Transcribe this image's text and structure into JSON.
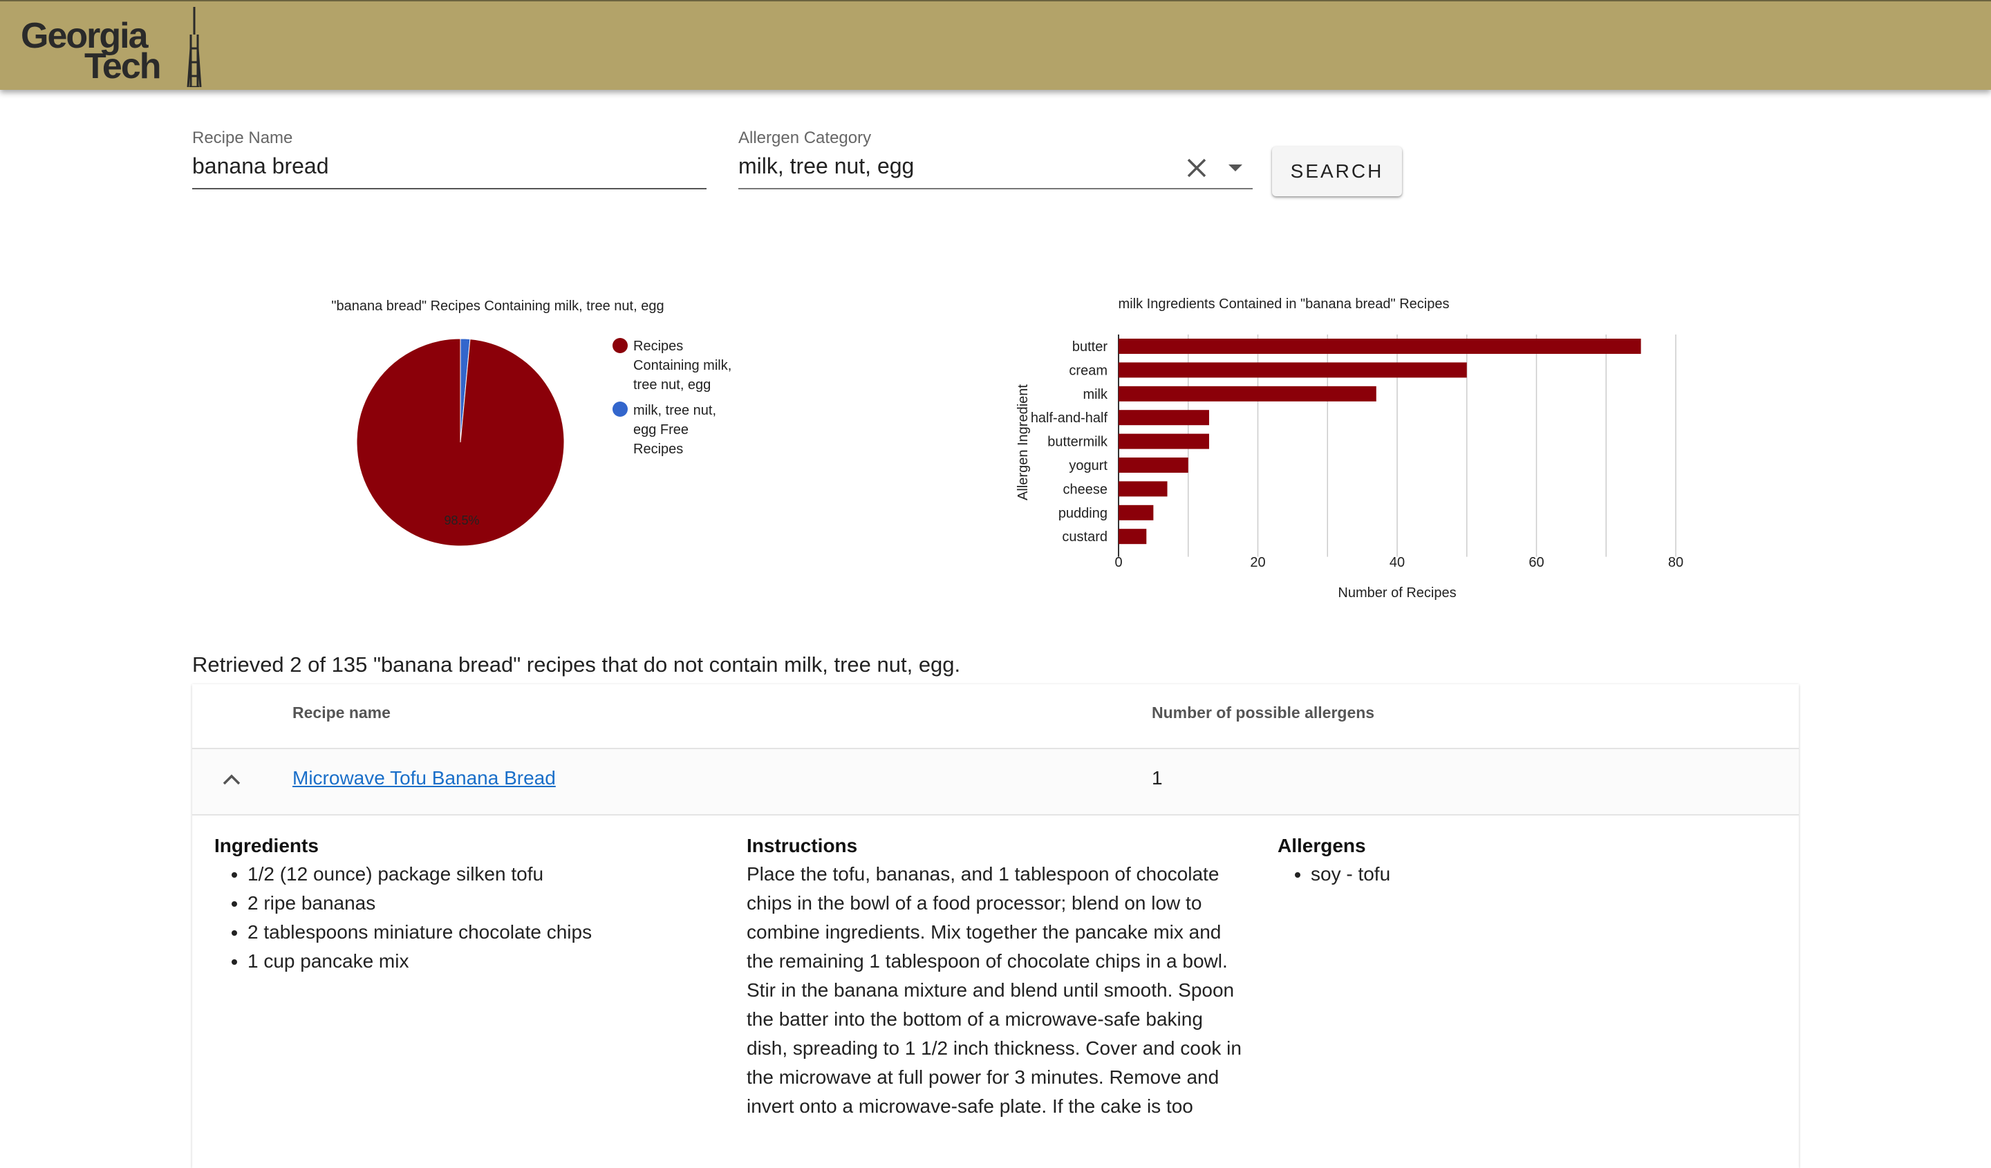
{
  "header": {
    "logo_line1": "Georgia",
    "logo_line2": "Tech",
    "brand_color": "#b3a369"
  },
  "search": {
    "recipe_label": "Recipe Name",
    "recipe_value": "banana bread",
    "allergen_label": "Allergen Category",
    "allergen_value": "milk, tree nut, egg",
    "search_button": "SEARCH"
  },
  "chart_data": [
    {
      "type": "pie",
      "title": "\"banana bread\" Recipes Containing milk, tree nut, egg",
      "labels": [
        "Recipes Containing milk, tree nut, egg",
        "milk, tree nut, egg Free Recipes"
      ],
      "values": [
        133,
        2
      ],
      "slice_label": "98.5%",
      "colors": [
        "#8b0009",
        "#3366cc"
      ],
      "legend": "right"
    },
    {
      "type": "bar",
      "orientation": "horizontal",
      "title": "milk Ingredients Contained in \"banana bread\" Recipes",
      "categories": [
        "butter",
        "cream",
        "milk",
        "half-and-half",
        "buttermilk",
        "yogurt",
        "cheese",
        "pudding",
        "custard"
      ],
      "values": [
        75,
        50,
        37,
        13,
        13,
        10,
        7,
        5,
        4
      ],
      "xlabel": "Number of Recipes",
      "ylabel": "Allergen Ingredient",
      "xticks": [
        "0",
        "20",
        "40",
        "60",
        "80"
      ],
      "xlim": [
        0,
        80
      ],
      "grid": true,
      "color": "#8b0009"
    }
  ],
  "summary": "Retrieved 2 of 135 \"banana bread\" recipes that do not contain milk, tree nut, egg.",
  "table": {
    "col_name": "Recipe name",
    "col_allergens": "Number of possible allergens",
    "rows": [
      {
        "name": "Microwave Tofu Banana Bread",
        "allergen_count": "1",
        "ingredients_title": "Ingredients",
        "ingredients": [
          "1/2 (12 ounce) package silken tofu",
          "2 ripe bananas",
          "2 tablespoons miniature chocolate chips",
          "1 cup pancake mix"
        ],
        "instructions_title": "Instructions",
        "instructions": "Place the tofu, bananas, and 1 tablespoon of chocolate chips in the bowl of a food processor; blend on low to combine ingredients. Mix together the pancake mix and the remaining 1 tablespoon of chocolate chips in a bowl. Stir in the banana mixture and blend until smooth. Spoon the batter into the bottom of a microwave-safe baking dish, spreading to 1 1/2 inch thickness. Cover and cook in the microwave at full power for 3 minutes. Remove and invert onto a microwave-safe plate. If the cake is too",
        "allergens_title": "Allergens",
        "allergens": [
          "soy - tofu"
        ]
      }
    ]
  }
}
